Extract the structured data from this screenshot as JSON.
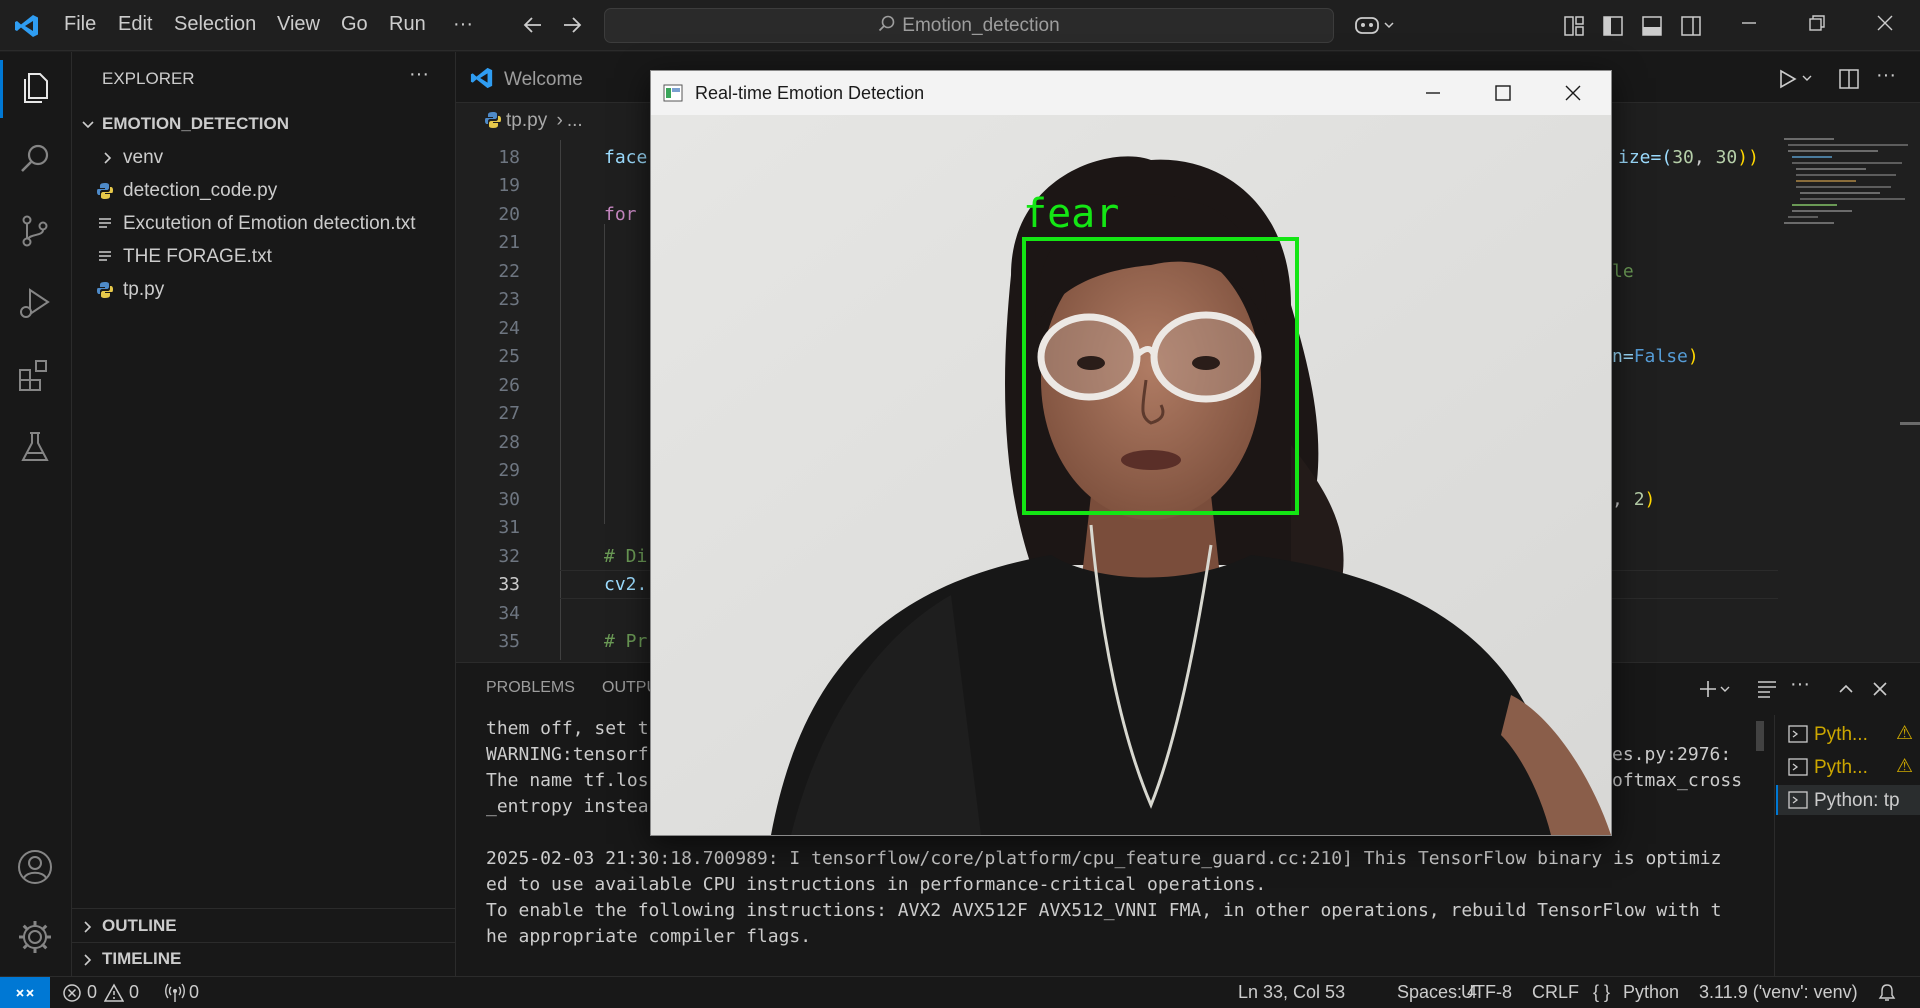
{
  "titlebar": {
    "menu": [
      "File",
      "Edit",
      "Selection",
      "View",
      "Go",
      "Run",
      "···"
    ],
    "search_text": "Emotion_detection"
  },
  "sidebar": {
    "header": "EXPLORER",
    "folder": "EMOTION_DETECTION",
    "items": [
      {
        "label": "venv",
        "type": "folder"
      },
      {
        "label": "detection_code.py",
        "type": "python"
      },
      {
        "label": "Excutetion of Emotion detection.txt",
        "type": "text"
      },
      {
        "label": "THE FORAGE.txt",
        "type": "text"
      },
      {
        "label": "tp.py",
        "type": "python"
      }
    ],
    "outline": "OUTLINE",
    "timeline": "TIMELINE"
  },
  "editor": {
    "tab_label": "Welcome",
    "breadcrumb_file": "tp.py",
    "breadcrumb_more": "...",
    "line_numbers": [
      "18",
      "19",
      "20",
      "21",
      "22",
      "23",
      "24",
      "25",
      "26",
      "27",
      "28",
      "29",
      "30",
      "31",
      "32",
      "33",
      "34",
      "35"
    ],
    "code_left": {
      "l18": "face",
      "l20": "for",
      "l32": "# Di",
      "l33": "cv2.",
      "l35": "# Pr"
    },
    "code_right": {
      "l18_a": "ize=(",
      "l18_b": "30",
      "l18_c": ", ",
      "l18_d": "30",
      "l18_e": "))",
      "l22": "le",
      "l25_a": "n=",
      "l25_b": "False",
      "l25_c": ")",
      "l30_a": ", ",
      "l30_b": "2",
      "l30_c": ")"
    }
  },
  "panel": {
    "tabs": [
      "PROBLEMS",
      "OUTPU"
    ],
    "terminal_lines": [
      "them off, set t",
      "WARNING:tensorf",
      "The name tf.los",
      "_entropy instea",
      "",
      "2025-02-03 21:30:18.700989: I tensorflow/core/platform/cpu_feature_guard.cc:210] This TensorFlow binary is optimiz",
      "ed to use available CPU instructions in performance-critical operations.",
      "To enable the following instructions: AVX2 AVX512F AVX512_VNNI FMA, in other operations, rebuild TensorFlow with t",
      "he appropriate compiler flags."
    ],
    "terminal_right": [
      "es.py:2976:",
      "oftmax_cross"
    ],
    "terminals": [
      "Pyth...",
      "Pyth...",
      "Python: tp"
    ]
  },
  "status": {
    "errors": "0",
    "warnings": "0",
    "ports": "0",
    "position": "Ln 33, Col 53",
    "spaces": "Spaces: 4",
    "encoding": "UTF-8",
    "eol": "CRLF",
    "lang_icon": "{ }",
    "language": "Python",
    "interpreter": "3.11.9 ('venv': venv)"
  },
  "popup": {
    "title": "Real-time Emotion Detection",
    "emotion_label": "fear",
    "box_color": "#14e614"
  },
  "colors": {
    "accent": "#0078d4",
    "keyword": "#c586c0",
    "variable": "#9cdcfe",
    "number": "#b5cea8",
    "comment": "#6a9955",
    "constant": "#569cd6",
    "warning": "#cca700"
  }
}
